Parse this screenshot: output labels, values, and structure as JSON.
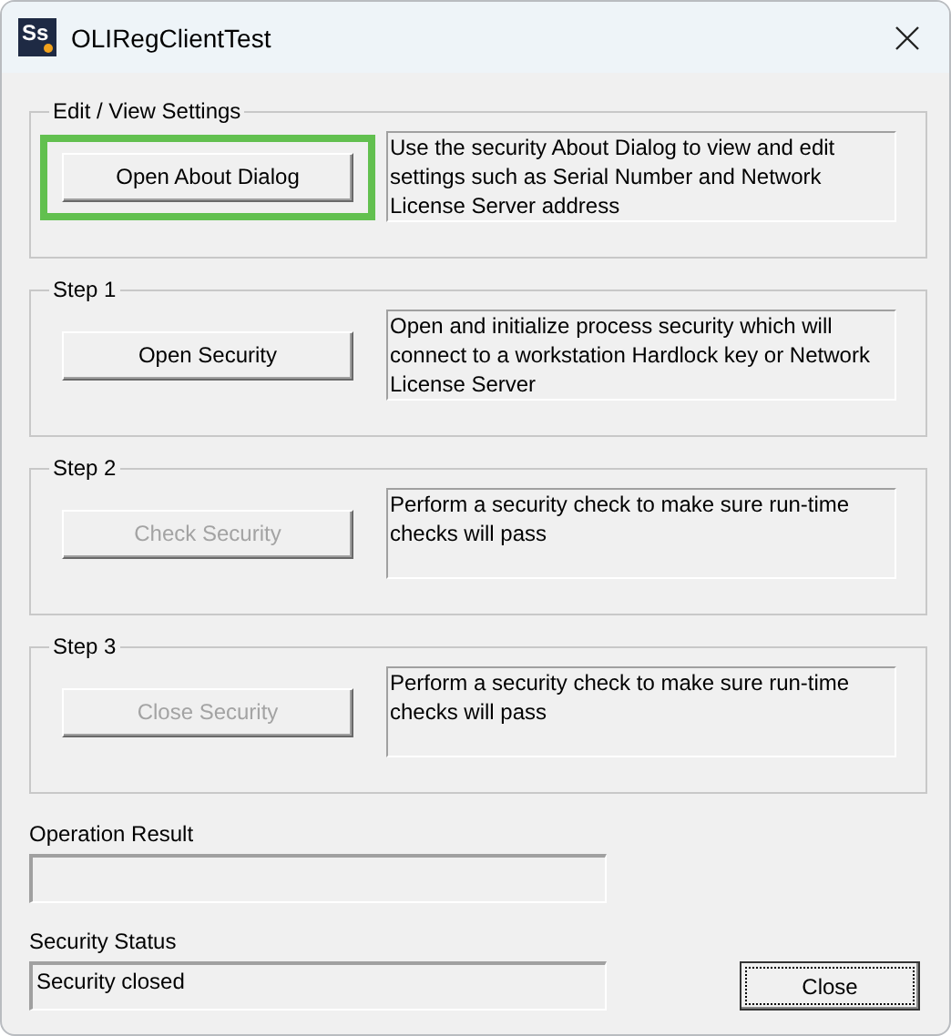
{
  "window": {
    "icon_text": "Ss",
    "title": "OLIRegClientTest"
  },
  "groups": [
    {
      "legend": "Edit / View Settings",
      "button": {
        "label": "Open About Dialog",
        "disabled": false,
        "highlighted": true
      },
      "description": "Use the security About Dialog to view and edit settings such as Serial Number and Network License Server address"
    },
    {
      "legend": "Step 1",
      "button": {
        "label": "Open Security",
        "disabled": false,
        "highlighted": false
      },
      "description": "Open and initialize process security which will connect to a workstation Hardlock key or Network License Server"
    },
    {
      "legend": "Step 2",
      "button": {
        "label": "Check Security",
        "disabled": true,
        "highlighted": false
      },
      "description": "Perform a security check to make sure run-time checks will pass"
    },
    {
      "legend": "Step 3",
      "button": {
        "label": "Close Security",
        "disabled": true,
        "highlighted": false
      },
      "description": "Perform a security check to make sure run-time checks will pass"
    }
  ],
  "operation_result": {
    "label": "Operation Result"
  },
  "security_status": {
    "label": "Security Status",
    "value": "Security closed"
  },
  "close_button": {
    "label": "Close",
    "focused": true
  }
}
